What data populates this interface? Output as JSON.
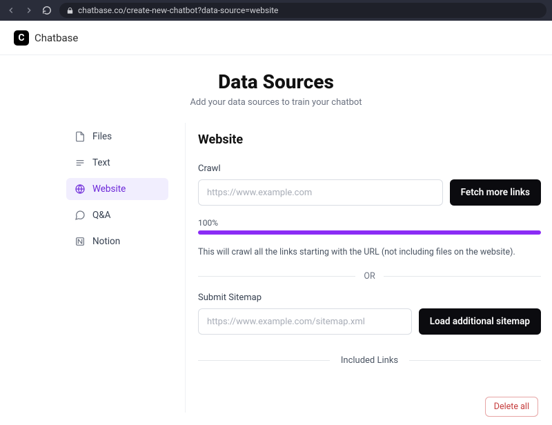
{
  "browser": {
    "url": "chatbase.co/create-new-chatbot?data-source=website"
  },
  "header": {
    "logo_letter": "C",
    "brand": "Chatbase"
  },
  "hero": {
    "title": "Data Sources",
    "subtitle": "Add your data sources to train your chatbot"
  },
  "sidebar": {
    "items": [
      {
        "label": "Files"
      },
      {
        "label": "Text"
      },
      {
        "label": "Website"
      },
      {
        "label": "Q&A"
      },
      {
        "label": "Notion"
      }
    ]
  },
  "panel": {
    "title": "Website",
    "crawl_label": "Crawl",
    "crawl_placeholder": "https://www.example.com",
    "fetch_button": "Fetch more links",
    "progress_text": "100%",
    "progress_percent": 100,
    "crawl_help": "This will crawl all the links starting with the URL (not including files on the website).",
    "or_text": "OR",
    "sitemap_label": "Submit Sitemap",
    "sitemap_placeholder": "https://www.example.com/sitemap.xml",
    "sitemap_button": "Load additional sitemap",
    "included_label": "Included Links",
    "delete_all": "Delete all"
  },
  "colors": {
    "accent": "#8b2cf5",
    "accent_bg": "#f1eefe",
    "danger": "#c53c3c"
  }
}
